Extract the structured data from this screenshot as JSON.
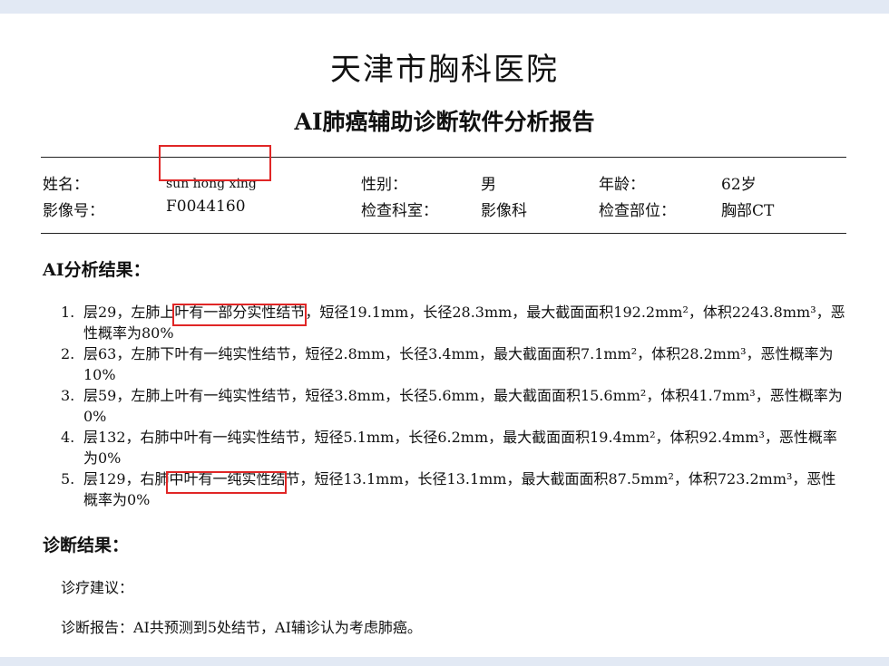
{
  "header": {
    "hospital": "天津市胸科医院",
    "report_title": "AI肺癌辅助诊断软件分析报告"
  },
  "patient": {
    "name_label": "姓名：",
    "name_value": "sun hong xing",
    "gender_label": "性别：",
    "gender_value": "男",
    "age_label": "年龄：",
    "age_value": "62岁",
    "image_no_label": "影像号：",
    "image_no_value": "F0044160",
    "dept_label": "检查科室：",
    "dept_value": "影像科",
    "part_label": "检查部位：",
    "part_value": "胸部CT"
  },
  "analysis": {
    "title": "AI分析结果：",
    "findings": [
      {
        "num": "1.",
        "text": "层29，左肺上叶有一部分实性结节，短径19.1mm，长径28.3mm，最大截面面积192.2mm²，体积2243.8mm³，恶性概率为80%"
      },
      {
        "num": "2.",
        "text": "层63，左肺下叶有一纯实性结节，短径2.8mm，长径3.4mm，最大截面面积7.1mm²，体积28.2mm³，恶性概率为10%"
      },
      {
        "num": "3.",
        "text": "层59，左肺上叶有一纯实性结节，短径3.8mm，长径5.6mm，最大截面面积15.6mm²，体积41.7mm³，恶性概率为0%"
      },
      {
        "num": "4.",
        "text": "层132，右肺中叶有一纯实性结节，短径5.1mm，长径6.2mm，最大截面面积19.4mm²，体积92.4mm³，恶性概率为0%"
      },
      {
        "num": "5.",
        "text": "层129，右肺中叶有一纯实性结节，短径13.1mm，长径13.1mm，最大截面面积87.5mm²，体积723.2mm³，恶性概率为0%"
      }
    ]
  },
  "diagnosis": {
    "title": "诊断结果：",
    "advice": "诊疗建议：",
    "report": "诊断报告：AI共预测到5处结节，AI辅诊认为考虑肺癌。"
  },
  "colors": {
    "background": "#e2e9f4",
    "annotation": "#e02626"
  }
}
